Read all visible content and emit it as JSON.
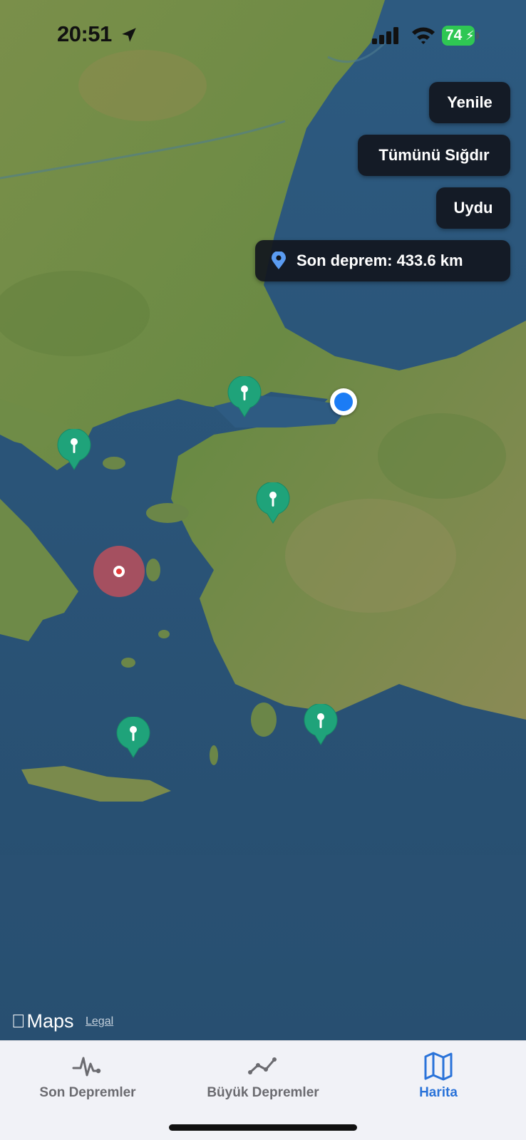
{
  "status_bar": {
    "time": "20:51",
    "battery_percent": "74",
    "location_icon": "location-arrow-icon",
    "signal_icon": "cellular-signal-icon",
    "wifi_icon": "wifi-icon"
  },
  "map_controls": {
    "refresh_label": "Yenile",
    "fit_all_label": "Tümünü Sığdır",
    "satellite_label": "Uydu",
    "last_quake_label": "Son deprem: 433.6 km",
    "last_quake_icon": "map-pin-icon"
  },
  "map": {
    "attribution_logo": "Maps",
    "legal_label": "Legal",
    "marker_icon": "earthquake-pin-icon",
    "highlight_icon": "selected-earthquake-circle",
    "user_location_icon": "user-location-dot",
    "colors": {
      "sea": "#2c5577",
      "land": "#6f8a45",
      "marker": "#1fa37a",
      "highlight": "#c8505a",
      "user": "#1b7cf5"
    }
  },
  "tab_bar": {
    "tabs": [
      {
        "label": "Son Depremler",
        "icon": "seismograph-icon",
        "active": false
      },
      {
        "label": "Büyük Depremler",
        "icon": "trend-line-icon",
        "active": false
      },
      {
        "label": "Harita",
        "icon": "map-icon",
        "active": true
      }
    ],
    "active_color": "#2a73d9"
  }
}
